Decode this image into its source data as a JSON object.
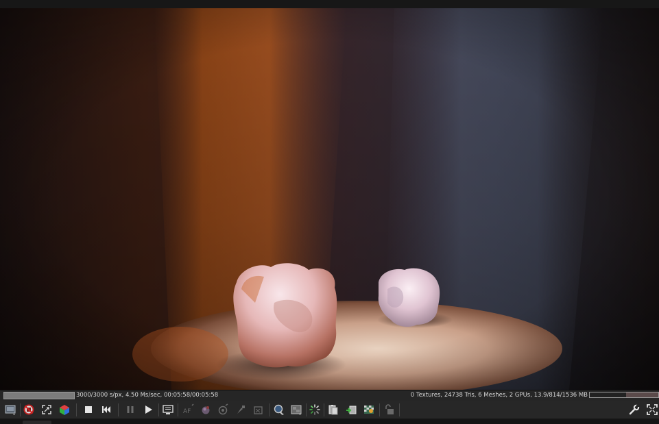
{
  "status": {
    "render_progress": 1.0,
    "render_stats": "3000/3000 s/px, 4.50 Ms/sec, 00:05:58/00:05:58",
    "scene_stats": "0 Textures, 24738 Tris, 6 Meshes, 2 GPUs, 13.9/814/1536 MB",
    "gpu_memory_used_fraction": 0.53
  },
  "toolbar": {
    "buttons": [
      "save-render-icon",
      "clear-cache-icon",
      "zoom-fit-icon",
      "color-cube-icon",
      "stop-icon",
      "restart-icon",
      "pause-icon",
      "play-icon",
      "display-settings-icon",
      "autofocus-icon",
      "material-picker-icon",
      "camera-target-icon",
      "white-point-picker-icon",
      "region-picker-icon",
      "refresh-scene-icon",
      "render-region-icon",
      "spinner-icon",
      "copy-clipboard-icon",
      "export-image-icon",
      "checker-alpha-icon",
      "lock-icon",
      "settings-wrench-icon",
      "fullscreen-icon"
    ]
  }
}
